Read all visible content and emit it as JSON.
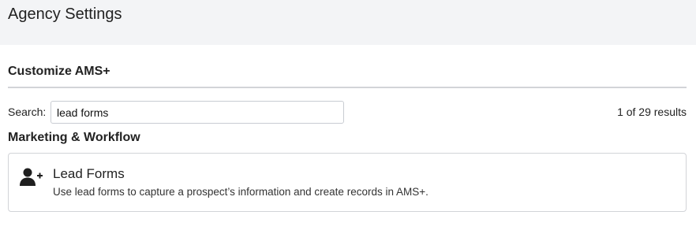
{
  "header": {
    "title": "Agency Settings"
  },
  "section": {
    "title": "Customize AMS+"
  },
  "search": {
    "label": "Search:",
    "value": "lead forms",
    "results": "1 of 29 results"
  },
  "groups": [
    {
      "heading": "Marketing & Workflow",
      "items": [
        {
          "icon": "user-plus-icon",
          "title": "Lead Forms",
          "description": "Use lead forms to capture a prospect’s information and create records in AMS+."
        }
      ]
    }
  ]
}
